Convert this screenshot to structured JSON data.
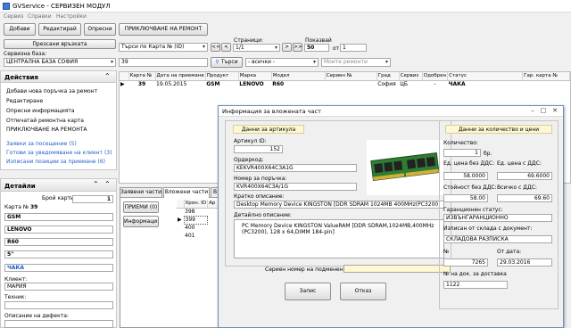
{
  "app": {
    "title": "GVService - СЕРВИЗЕН МОДУЛ"
  },
  "menu": [
    "Сервиз",
    "Справки",
    "Настройки"
  ],
  "toolbar": {
    "add": "Добави",
    "edit": "Редактирай",
    "repairs": "Опресни",
    "finish": "ПРИКЛЮЧВАНЕ НА РЕМОНТ"
  },
  "filter": {
    "refresh_link": "Презсани връзката",
    "service_base_label": "Сервизна база:",
    "service_base_value": "ЦЕНТРАЛНА БАЗА СОФИЯ",
    "search_by": "Търси по Карта № (ID)",
    "pages_label": "Страници:",
    "page_value": "1/1",
    "shown_label": "Показвай",
    "shown_value": "50",
    "of_label": "от",
    "of_value": "1",
    "search_value": "39",
    "search_button": "Търси",
    "all_value": "- всички -",
    "my_repairs": "Моите ремонти",
    "nav_first": "<<",
    "nav_prev": "<",
    "nav_next": ">",
    "nav_last": ">>"
  },
  "actions": {
    "title": "Действия",
    "items": [
      "Добави нова поръчка за ремонт",
      "Редактиране",
      "Опресни информацията",
      "Отпечатай ремонтна карта",
      "ПРИКЛЮЧВАНЕ НА РЕМОНТА"
    ],
    "links": [
      "Заявки за посещение (5)",
      "Готови за уведомяване на клиент (3)",
      "Изписани позиции за приемане (6)"
    ]
  },
  "details": {
    "title": "Детайли",
    "card_count_label": "Брой картис:",
    "card_count_value": "1",
    "card_no_label": "Карта №",
    "card_no_value": "39",
    "fields": [
      "GSM",
      "LENOVO",
      "R60",
      "5\"",
      "ЧАКА"
    ],
    "client_label": "Клиент:",
    "client_value": "МАРИЯ",
    "tech_label": "Техник:",
    "defect_label": "Описание на дефекта:"
  },
  "table": {
    "headers": [
      "Карта №",
      "Дата на приемане",
      "Продукт",
      "Марка",
      "Модел",
      "Сериен №",
      "Град",
      "Сервиз",
      "Одобрен",
      "Статус",
      "Гар. карта №"
    ],
    "rows": [
      [
        "39",
        "19.05.2015",
        "GSM",
        "LENOVO",
        "R60",
        "",
        "София",
        "ЦБ",
        "-",
        "ЧАКА",
        ""
      ]
    ]
  },
  "bottom_tabs": {
    "tabs": [
      "Заявени части",
      "Вложени части",
      "В"
    ],
    "receive_btn": "ПРИЕМИ (0)",
    "info_btn": "Информация",
    "grid_headers": [
      "Хрон. ID",
      "Ар"
    ],
    "grid_rows": [
      "398",
      "399",
      "400",
      "401"
    ]
  },
  "dialog": {
    "title": "Информация за вложената част",
    "article_section": "Данни за артикула",
    "article_id_label": "Артикул ID:",
    "article_id_value": "152",
    "order_code_label": "Ордеркод:",
    "order_code_value": "KEKVR400X64C3A1G",
    "order_no_label": "Номер за поръчка:",
    "order_no_value": "KVR400X64C3A/1G",
    "short_desc_label": "Кратко описание:",
    "short_desc_value": "Desktop Memory Device KINGSTON [DDR SDRAM 1024MB 400MHz(PC3200)",
    "detail_desc_label": "Детайлно описание:",
    "detail_desc_value": "PC Memory Device KINGSTON ValueRAM [DDR SDRAM,1024MB,400MHz (PC3200), 128 x 64,DIMM 184-pin]",
    "serial_label": "Сериен номер на подменената част:",
    "save_btn": "Запис",
    "cancel_btn": "Отказ",
    "qty_section": "Данни за количество и цени",
    "qty_label": "Количество:",
    "qty_value": "1",
    "qty_unit": "бр.",
    "unit_price_novat_label": "Ед. цена без ДДС:",
    "unit_price_novat_value": "58.0000",
    "unit_price_vat_label": "Ед. цена с ДДС:",
    "unit_price_vat_value": "69.6000",
    "value_novat_label": "Стойност без ДДС:",
    "value_novat_value": "58.00",
    "total_vat_label": "Всичко с ДДС:",
    "total_vat_value": "69.60",
    "warranty_label": "Гаранционен статус:",
    "warranty_value": "ИЗВЪНГАРАНЦИОННО",
    "warehouse_label": "Изписан от склада с документ:",
    "warehouse_value": "СКЛАДОВА РАЗПИСКА",
    "no_label": "№",
    "no_value": "7265",
    "date_label": "От дата:",
    "date_value": "29.03.2016",
    "delivery_doc_label": "№ на док. за доставка",
    "delivery_doc_value": "1122",
    "colors": {
      "title_bg": "#fdf7d2",
      "accent": "#1f5fc4"
    }
  }
}
